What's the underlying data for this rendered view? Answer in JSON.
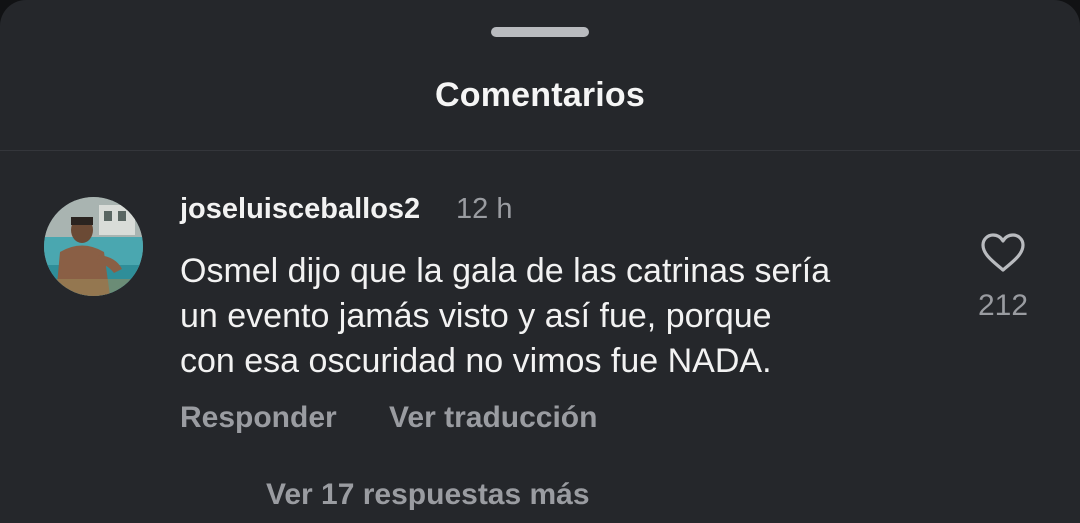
{
  "sheet": {
    "title": "Comentarios"
  },
  "comment": {
    "username": "joseluisceballos2",
    "time": "12 h",
    "text_lines": [
      "Osmel dijo que la gala de las catrinas sería",
      "un evento jamás visto y así fue, porque",
      "con esa oscuridad no vimos fue NADA."
    ],
    "reply_label": "Responder",
    "translate_label": "Ver traducción",
    "like_icon": "heart-outline-icon",
    "like_count": "212",
    "view_replies_label": "Ver 17 respuestas más"
  },
  "colors": {
    "background": "#25272b",
    "primary_text": "#f2f2f2",
    "secondary_text": "#9a9ca1"
  }
}
